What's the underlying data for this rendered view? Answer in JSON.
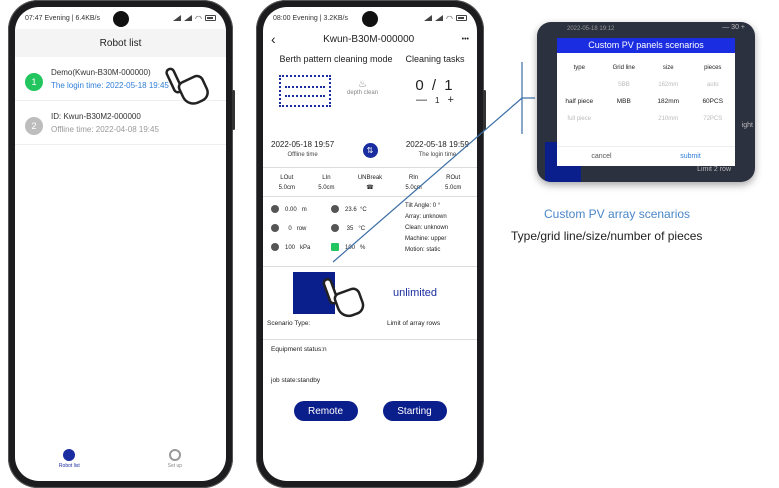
{
  "phone1": {
    "status_time": "07:47 Evening | 6.4KB/s",
    "title": "Robot list",
    "robots": [
      {
        "num": "1",
        "name": "Demo(Kwun-B30M-000000)",
        "sub": "The login time:  2022-05-18 19:45",
        "color": "#22c55e",
        "sub_color": "#2f7ed8"
      },
      {
        "num": "2",
        "name": "ID:  Kwun-B30M2-000000",
        "sub": "Offline time:  2022-04-08 19:45",
        "color": "#bdbdbd",
        "sub_color": "#999999"
      }
    ],
    "tabs": [
      {
        "label": "Robot list",
        "icon": "robot-list-icon"
      },
      {
        "label": "Set up",
        "icon": "settings-gear-icon"
      }
    ]
  },
  "phone2": {
    "status_time": "08:00 Evening | 3.2KB/s",
    "nav_title": "Kwun-B30M-000000",
    "back_glyph": "‹",
    "more_glyph": "•••",
    "mode_title": "Berth pattern cleaning mode",
    "depth_label": "depth clean",
    "tasks_title": "Cleaning tasks",
    "tasks_count": "0 / 1",
    "stepper": {
      "minus": "—",
      "value": "1",
      "plus": "+"
    },
    "offline": {
      "time": "2022-05-18 19:57",
      "label": "Offline time"
    },
    "login": {
      "time": "2022-05-18 19:59",
      "label": "The login time"
    },
    "params": [
      {
        "name": "LOut",
        "value": "5.0cm"
      },
      {
        "name": "LIn",
        "value": "5.0cm"
      },
      {
        "name": "UNBreak",
        "value": "☎"
      },
      {
        "name": "RIn",
        "value": "5.0cm"
      },
      {
        "name": "ROut",
        "value": "5.0cm"
      }
    ],
    "sensors_left": [
      {
        "value": "0.00",
        "unit": "m"
      },
      {
        "value": "0",
        "unit": "row"
      },
      {
        "value": "100",
        "unit": "kPa"
      }
    ],
    "sensors_mid": [
      {
        "value": "23.6",
        "unit": "°C"
      },
      {
        "value": "35",
        "unit": "°C"
      },
      {
        "value": "100",
        "unit": "%"
      }
    ],
    "status_lines": [
      "Tilt Angle:  0    °",
      "Array:  unknown",
      "Clean:  unknown",
      "Machine:  upper",
      "Motion:  static"
    ],
    "unlimited": "unlimited",
    "scenario_type": "Scenario Type:",
    "limit_rows": "Limit of array rows",
    "equipment_status": "Equipment status:n",
    "job_state": "job state:standby",
    "remote_btn": "Remote",
    "starting_btn": "Starting"
  },
  "callout": {
    "modal_title": "Custom PV panels scenarios",
    "bg_top_left": "2022-05-18 19:12",
    "bg_top_right": "— 30 +",
    "headers": [
      "type",
      "Grid line",
      "size",
      "pieces"
    ],
    "rows": [
      {
        "type": "",
        "grid": "SBB",
        "size": "162mm",
        "pieces": "auto",
        "faint": true
      },
      {
        "type": "half piece",
        "grid": "MBB",
        "size": "182mm",
        "pieces": "60PCS",
        "faint": false
      },
      {
        "type": "full piece",
        "grid": "",
        "size": "210mm",
        "pieces": "72PCS",
        "faint": true
      }
    ],
    "cancel": "cancel",
    "submit": "submit",
    "bg_right_text": "ight",
    "bg_bottom_text": "Limit 2 row"
  },
  "captions": {
    "line1": "Custom PV  array scenarios",
    "line2": "Type/grid line/size/number of pieces"
  },
  "colors": {
    "accent": "#0b1f8c",
    "online": "#22c55e",
    "link": "#2f7ed8",
    "modal_header": "#1a2de0"
  }
}
